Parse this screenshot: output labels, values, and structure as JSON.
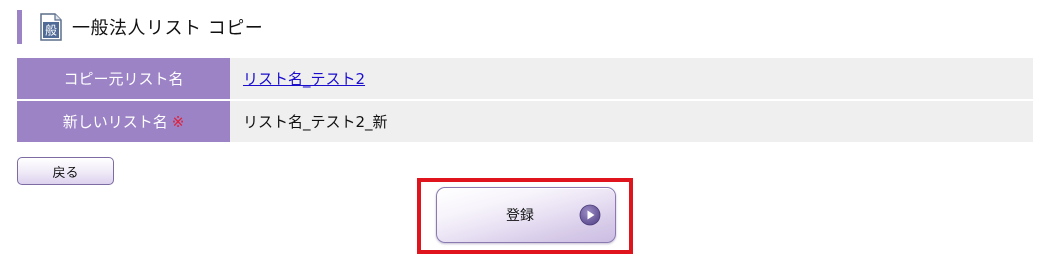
{
  "title": {
    "icon_char": "般",
    "text": "一般法人リスト コピー"
  },
  "form": {
    "rows": [
      {
        "label": "コピー元リスト名",
        "value": "リスト名_テスト2",
        "is_link": true
      },
      {
        "label": "新しいリスト名",
        "required_mark": "※",
        "value": "リスト名_テスト2_新"
      }
    ]
  },
  "buttons": {
    "back_label": "戻る",
    "register_label": "登録"
  },
  "colors": {
    "accent": "#9b83c5",
    "cell_bg": "#efefef",
    "highlight": "#e0141d",
    "required": "#e0203a"
  },
  "icons": {
    "title_icon": "document-icon",
    "register_icon": "play-circle-icon"
  }
}
